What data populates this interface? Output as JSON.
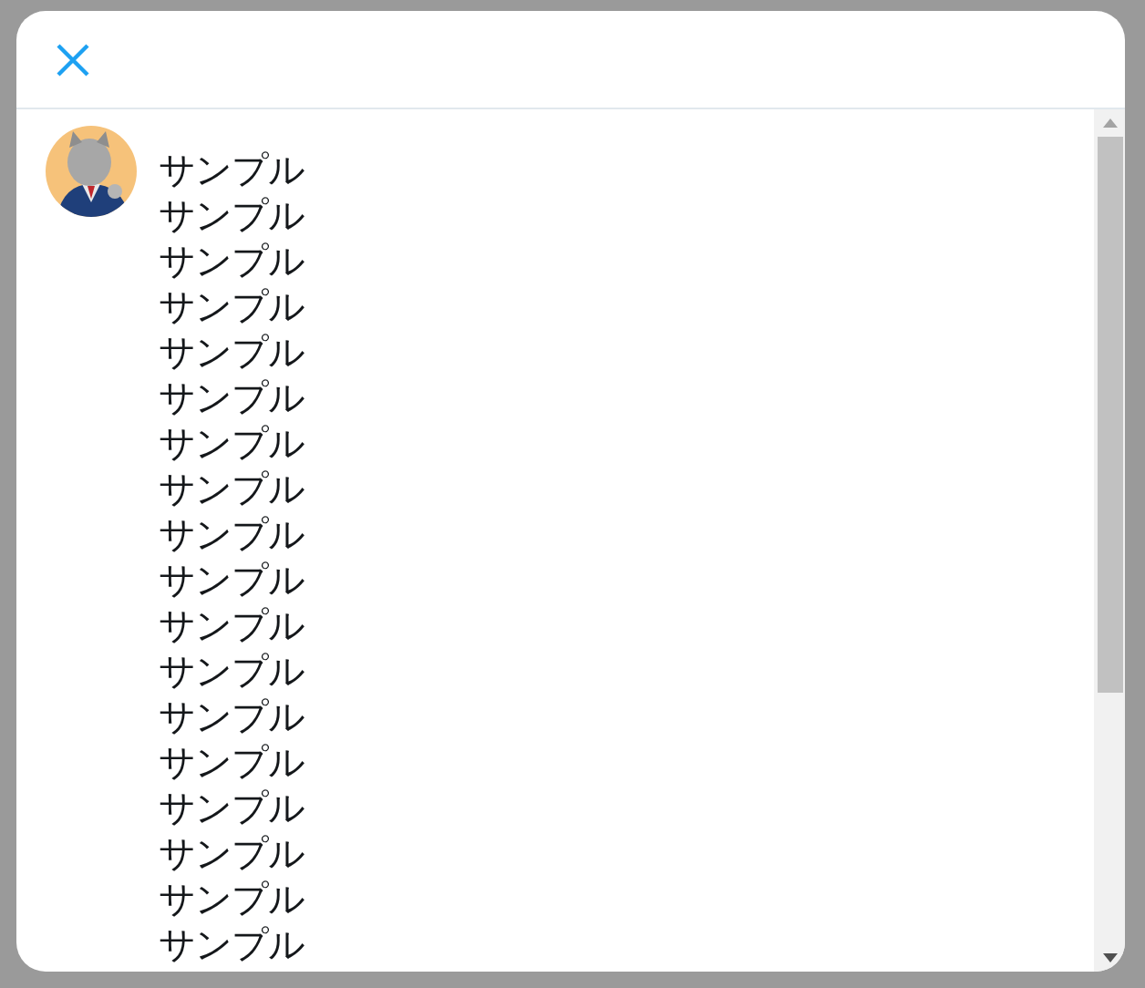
{
  "compose": {
    "lines": [
      "サンプル",
      "サンプル",
      "サンプル",
      "サンプル",
      "サンプル",
      "サンプル",
      "サンプル",
      "サンプル",
      "サンプル",
      "サンプル",
      "サンプル",
      "サンプル",
      "サンプル",
      "サンプル",
      "サンプル",
      "サンプル",
      "サンプル",
      "サンプル"
    ]
  }
}
